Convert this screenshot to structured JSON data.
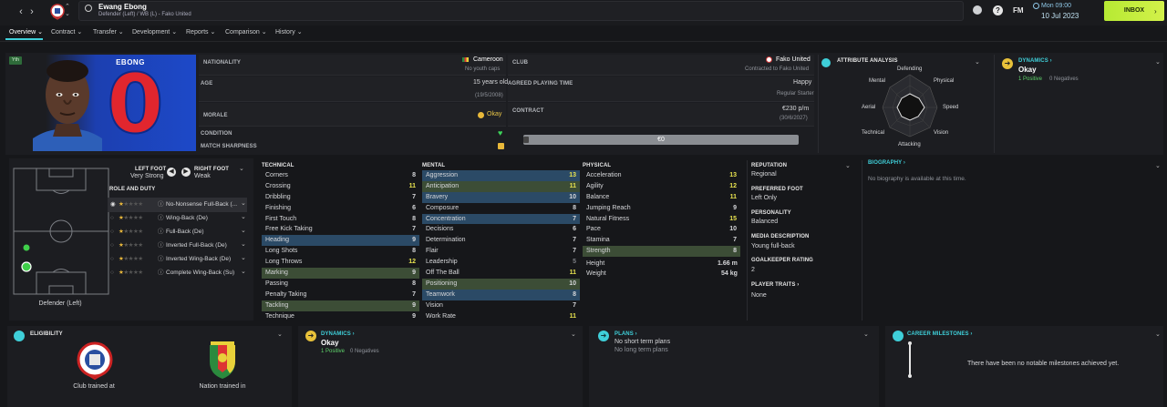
{
  "topbar": {
    "back": "‹",
    "forward": "›",
    "player_name": "Ewang Ebong",
    "player_subtitle": "Defender (Left) / WB (L) - Fako United",
    "date_day": "Mon 09:00",
    "date_full": "10 Jul 2023",
    "fm_label": "FM",
    "inbox_label": "INBOX"
  },
  "tabs": [
    {
      "label": "Overview"
    },
    {
      "label": "Contract"
    },
    {
      "label": "Transfer"
    },
    {
      "label": "Development"
    },
    {
      "label": "Reports"
    },
    {
      "label": "Comparison"
    },
    {
      "label": "History"
    }
  ],
  "profile": {
    "age_badge": "Yth",
    "shirt_name": "EBONG",
    "shirt_number": "0"
  },
  "info": {
    "nationality_label": "NATIONALITY",
    "nationality": "Cameroon",
    "youth_caps": "No youth caps",
    "age_label": "AGE",
    "age": "15 years old",
    "dob": "(19/5/2008)",
    "morale_label": "MORALE",
    "morale": "Okay",
    "condition_label": "CONDITION",
    "sharpness_label": "MATCH SHARPNESS",
    "club_label": "CLUB",
    "club": "Fako United",
    "contract_status": "Contracted to Fako United",
    "playing_time_label": "AGREED PLAYING TIME",
    "happiness": "Happy",
    "playing_time": "Regular Starter",
    "contract_label": "CONTRACT",
    "wage": "€230 p/m",
    "contract_end": "(30/6/2027)",
    "value": "€0"
  },
  "attribute_analysis": {
    "title": "ATTRIBUTE ANALYSIS",
    "axes": [
      "Defending",
      "Physical",
      "Speed",
      "Vision",
      "Attacking",
      "Technical",
      "Aerial",
      "Mental"
    ]
  },
  "dynamics_top": {
    "title": "DYNAMICS",
    "value": "Okay",
    "positives": "1 Positive",
    "negatives": "0 Negatives"
  },
  "feet": {
    "left_label": "LEFT FOOT",
    "left_value": "Very Strong",
    "right_label": "RIGHT FOOT",
    "right_value": "Weak"
  },
  "roles": {
    "title": "ROLE AND DUTY",
    "items": [
      {
        "name": "No-Nonsense Full-Back (..."
      },
      {
        "name": "Wing-Back (De)"
      },
      {
        "name": "Full-Back (De)"
      },
      {
        "name": "Inverted Full-Back (De)"
      },
      {
        "name": "Inverted Wing-Back (De)"
      },
      {
        "name": "Complete Wing-Back (Su)"
      }
    ]
  },
  "pitch_caption": "Defender (Left)",
  "technical": {
    "title": "TECHNICAL",
    "items": [
      {
        "name": "Corners",
        "value": "8"
      },
      {
        "name": "Crossing",
        "value": "11"
      },
      {
        "name": "Dribbling",
        "value": "7"
      },
      {
        "name": "Finishing",
        "value": "6"
      },
      {
        "name": "First Touch",
        "value": "8"
      },
      {
        "name": "Free Kick Taking",
        "value": "7"
      },
      {
        "name": "Heading",
        "value": "9"
      },
      {
        "name": "Long Shots",
        "value": "8"
      },
      {
        "name": "Long Throws",
        "value": "12"
      },
      {
        "name": "Marking",
        "value": "9"
      },
      {
        "name": "Passing",
        "value": "8"
      },
      {
        "name": "Penalty Taking",
        "value": "7"
      },
      {
        "name": "Tackling",
        "value": "9"
      },
      {
        "name": "Technique",
        "value": "9"
      }
    ]
  },
  "mental": {
    "title": "MENTAL",
    "items": [
      {
        "name": "Aggression",
        "value": "13"
      },
      {
        "name": "Anticipation",
        "value": "11"
      },
      {
        "name": "Bravery",
        "value": "10"
      },
      {
        "name": "Composure",
        "value": "8"
      },
      {
        "name": "Concentration",
        "value": "7"
      },
      {
        "name": "Decisions",
        "value": "6"
      },
      {
        "name": "Determination",
        "value": "7"
      },
      {
        "name": "Flair",
        "value": "7"
      },
      {
        "name": "Leadership",
        "value": "5"
      },
      {
        "name": "Off The Ball",
        "value": "11"
      },
      {
        "name": "Positioning",
        "value": "10"
      },
      {
        "name": "Teamwork",
        "value": "8"
      },
      {
        "name": "Vision",
        "value": "7"
      },
      {
        "name": "Work Rate",
        "value": "11"
      }
    ]
  },
  "physical": {
    "title": "PHYSICAL",
    "items": [
      {
        "name": "Acceleration",
        "value": "13"
      },
      {
        "name": "Agility",
        "value": "12"
      },
      {
        "name": "Balance",
        "value": "11"
      },
      {
        "name": "Jumping Reach",
        "value": "9"
      },
      {
        "name": "Natural Fitness",
        "value": "15"
      },
      {
        "name": "Pace",
        "value": "10"
      },
      {
        "name": "Stamina",
        "value": "7"
      },
      {
        "name": "Strength",
        "value": "8"
      }
    ],
    "height_label": "Height",
    "height": "1.66 m",
    "weight_label": "Weight",
    "weight": "54 kg"
  },
  "details": {
    "reputation_label": "REPUTATION",
    "reputation": "Regional",
    "foot_label": "PREFERRED FOOT",
    "foot": "Left Only",
    "personality_label": "PERSONALITY",
    "personality": "Balanced",
    "media_label": "MEDIA DESCRIPTION",
    "media": "Young full-back",
    "gk_label": "GOALKEEPER RATING",
    "gk": "2",
    "traits_label": "PLAYER TRAITS",
    "traits": "None"
  },
  "biography": {
    "title": "BIOGRAPHY",
    "text": "No biography is available at this time."
  },
  "eligibility": {
    "title": "ELIGIBILITY",
    "club_caption": "Club trained at",
    "nation_caption": "Nation trained in"
  },
  "dynamics_bottom": {
    "title": "DYNAMICS",
    "value": "Okay",
    "positives": "1 Positive",
    "negatives": "0 Negatives"
  },
  "plans": {
    "title": "PLANS",
    "short": "No short term plans",
    "long": "No long term plans"
  },
  "milestones": {
    "title": "CAREER MILESTONES",
    "text": "There have been no notable milestones achieved yet."
  },
  "colors": {
    "accent": "#3fcfd9",
    "inbox": "#c6ee3e",
    "highlight_blue": "#2b4a66",
    "highlight_green": "#3c4d36",
    "good_value": "#e8e34f"
  }
}
